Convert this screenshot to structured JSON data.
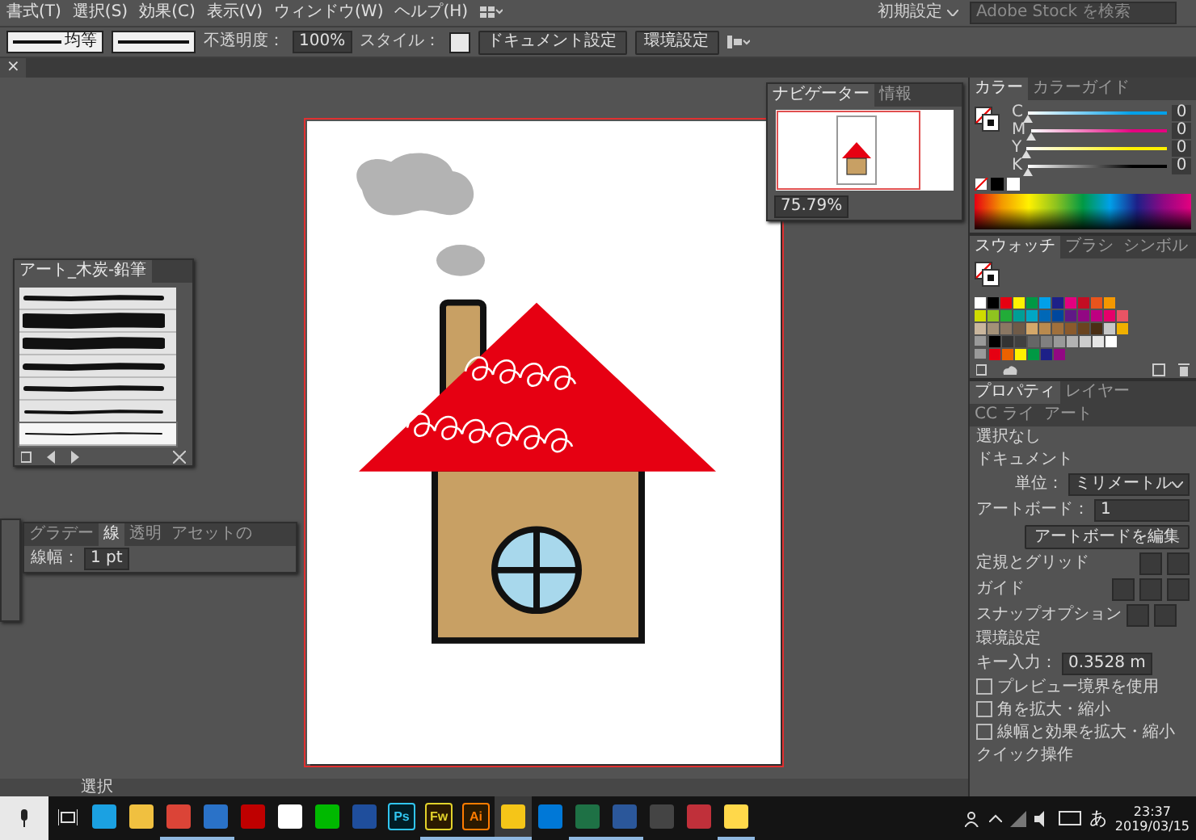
{
  "menu_bar": {
    "menus": [
      "書式(T)",
      "選択(S)",
      "効果(C)",
      "表示(V)",
      "ウィンドウ(W)",
      "ヘルプ(H)"
    ],
    "workspace": "初期設定",
    "search": {
      "placeholder": "Adobe Stock を検索"
    }
  },
  "control_bar": {
    "stroke_profile": "均等",
    "opacity_label": "不透明度：",
    "opacity": "100%",
    "style_label": "スタイル：",
    "buttons": [
      "ドキュメント設定",
      "環境設定"
    ]
  },
  "document_tab": {
    "close": "×"
  },
  "brush_panel": {
    "title": "アート_木炭-鉛筆",
    "brushes": [
      {
        "selected": false
      },
      {
        "selected": false
      },
      {
        "selected": false
      },
      {
        "selected": false
      },
      {
        "selected": false
      },
      {
        "selected": false
      },
      {
        "selected": true
      }
    ]
  },
  "stroke_panel": {
    "tabs": [
      {
        "label": "グラデー",
        "selected": false
      },
      {
        "label": "線",
        "selected": true
      },
      {
        "label": "透明",
        "selected": false
      },
      {
        "label": "アセットの",
        "selected": false
      }
    ],
    "weight_label": "線幅：",
    "weight": "1 pt"
  },
  "navigator": {
    "tabs": [
      {
        "label": "ナビゲーター",
        "selected": true
      },
      {
        "label": "情報",
        "selected": false
      }
    ],
    "zoom": "75.79%"
  },
  "color_panel": {
    "tabs": [
      {
        "label": "カラー",
        "selected": true
      },
      {
        "label": "カラーガイド",
        "selected": false
      }
    ],
    "channels": [
      {
        "name": "C",
        "level": 0,
        "reading": "0",
        "color": "#00a0e9"
      },
      {
        "name": "M",
        "level": 0,
        "reading": "0",
        "color": "#e4007f"
      },
      {
        "name": "Y",
        "level": 0,
        "reading": "0",
        "color": "#fff100"
      },
      {
        "name": "K",
        "level": 0,
        "reading": "0",
        "color": "#000000"
      }
    ]
  },
  "swatches_panel": {
    "tabs": [
      {
        "label": "スウォッチ",
        "selected": true
      },
      {
        "label": "ブラシ",
        "selected": false
      },
      {
        "label": "シンボル",
        "selected": false
      }
    ],
    "rows": [
      [
        {
          "color": "#ffffff"
        },
        {
          "color": "#000000"
        },
        {
          "color": "#e60012"
        },
        {
          "color": "#fff100"
        },
        {
          "color": "#009944"
        },
        {
          "color": "#00a0e9"
        },
        {
          "color": "#1d2088"
        },
        {
          "color": "#e4007f"
        },
        {
          "color": "#c30d23"
        },
        {
          "color": "#e9541c"
        },
        {
          "color": "#f39800"
        }
      ],
      [
        {
          "color": "#cfdb00"
        },
        {
          "color": "#8fc31f"
        },
        {
          "color": "#22ac38"
        },
        {
          "color": "#009e96"
        },
        {
          "color": "#00a7c4"
        },
        {
          "color": "#0068b7"
        },
        {
          "color": "#00479d"
        },
        {
          "color": "#601986"
        },
        {
          "color": "#920783"
        },
        {
          "color": "#be0081"
        },
        {
          "color": "#e5006a"
        },
        {
          "color": "#e95464"
        }
      ],
      [
        {
          "color": "#c9b69d"
        },
        {
          "color": "#a39178"
        },
        {
          "color": "#8a7763"
        },
        {
          "color": "#6f5b48"
        },
        {
          "color": "#d4a86a"
        },
        {
          "color": "#b98a4e"
        },
        {
          "color": "#a0703c"
        },
        {
          "color": "#8a5a2c"
        },
        {
          "color": "#6a4420"
        },
        {
          "color": "#4a2e14"
        },
        {
          "color": "#c8c8c8"
        },
        {
          "color": "#f0b000"
        }
      ],
      [
        {
          "color": "#000000"
        },
        {
          "color": "#333333"
        },
        {
          "color": "#404040"
        },
        {
          "color": "#666666"
        },
        {
          "color": "#808080"
        },
        {
          "color": "#999999"
        },
        {
          "color": "#b3b3b3"
        },
        {
          "color": "#cccccc"
        },
        {
          "color": "#e6e6e6"
        },
        {
          "color": "#ffffff"
        }
      ],
      [
        {
          "color": "#e60012"
        },
        {
          "color": "#eb6100"
        },
        {
          "color": "#fff100"
        },
        {
          "color": "#009944"
        },
        {
          "color": "#1d2088"
        },
        {
          "color": "#920783"
        }
      ]
    ]
  },
  "properties_panel": {
    "tabs": [
      {
        "label": "プロパティ",
        "selected": true
      },
      {
        "label": "レイヤー",
        "selected": false
      },
      {
        "label": "CC ライ",
        "selected": false
      },
      {
        "label": "アート",
        "selected": false
      }
    ],
    "selection": "選択なし",
    "document_heading": "ドキュメント",
    "unit_label": "単位：",
    "unit": "ミリメートル",
    "artboard_label": "アートボード：",
    "artboard": "1",
    "edit_artboard_button": "アートボードを編集",
    "rulers_label": "定規とグリッド",
    "guides_label": "ガイド",
    "snap_label": "スナップオプション",
    "preferences_heading": "環境設定",
    "key_label": "キー入力：",
    "key_value": "0.3528 m",
    "checkboxes": [
      {
        "label": "プレビュー境界を使用",
        "checked": false
      },
      {
        "label": "角を拡大・縮小",
        "checked": false
      },
      {
        "label": "線幅と効果を拡大・縮小",
        "checked": false
      }
    ],
    "quick_actions": "クイック操作"
  },
  "status_bar": {
    "tool": "選択"
  },
  "taskbar": {
    "apps": [
      {
        "kind": "ie",
        "running": false,
        "selected": false
      },
      {
        "kind": "folder",
        "running": false,
        "selected": false
      },
      {
        "kind": "chrome",
        "running": true,
        "selected": false
      },
      {
        "kind": "mail",
        "running": true,
        "selected": false
      },
      {
        "kind": "filezilla",
        "running": false,
        "selected": false
      },
      {
        "kind": "paint",
        "running": false,
        "selected": false
      },
      {
        "kind": "chat",
        "running": false,
        "selected": false
      },
      {
        "kind": "ledger",
        "running": false,
        "selected": false
      },
      {
        "kind": "tool",
        "label": "Ps",
        "running": false,
        "selected": false
      },
      {
        "kind": "tool",
        "label": "Fw",
        "running": true,
        "selected": false
      },
      {
        "kind": "tool",
        "label": "Ai",
        "running": true,
        "selected": false
      },
      {
        "kind": "note",
        "running": true,
        "selected": true
      },
      {
        "kind": "edge",
        "running": false,
        "selected": false
      },
      {
        "kind": "sheet",
        "running": true,
        "selected": false
      },
      {
        "kind": "doc",
        "running": true,
        "selected": false
      },
      {
        "kind": "calc",
        "running": false,
        "selected": false
      },
      {
        "kind": "redapp",
        "running": false,
        "selected": false
      },
      {
        "kind": "yellowfolder",
        "running": true,
        "selected": false
      }
    ],
    "ime": "あ",
    "time": "23:37",
    "date": "2019/03/15"
  }
}
